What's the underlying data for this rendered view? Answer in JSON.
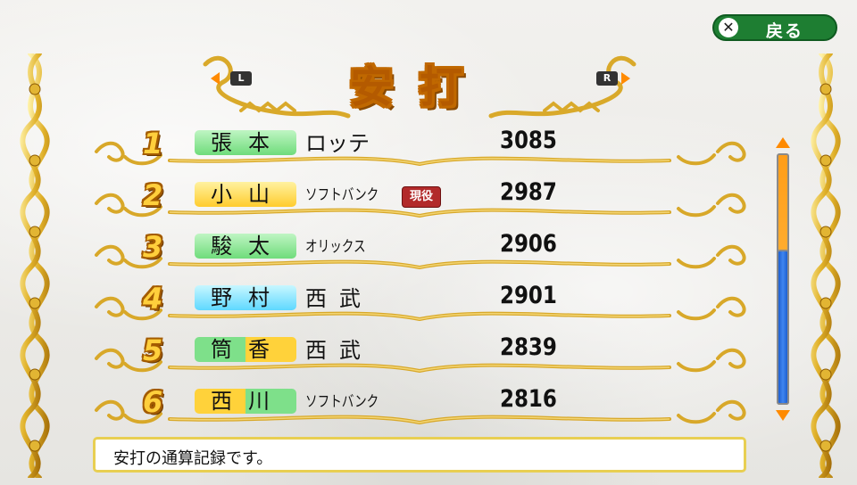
{
  "back_button": {
    "label": "戻る",
    "icon": "cross-button-icon"
  },
  "header": {
    "title": "安打",
    "left_shoulder": "L",
    "right_shoulder": "R"
  },
  "colors": {
    "green_badge": "#7ee08a",
    "yellow_badge": "#ffd23a",
    "cyan_badge": "#6fe3ff",
    "accent_orange": "#ff9d18",
    "thumb_blue": "#2f74e6",
    "active_red": "#b22a2a"
  },
  "rankings": [
    {
      "rank": "1",
      "name": "張本",
      "team": "ロッテ",
      "active": "",
      "hits": "3085",
      "badge_color": "green"
    },
    {
      "rank": "2",
      "name": "小山",
      "team": "ソフトバンク",
      "active": "現役",
      "hits": "2987",
      "badge_color": "yellow"
    },
    {
      "rank": "3",
      "name": "駿太",
      "team": "オリックス",
      "active": "",
      "hits": "2906",
      "badge_color": "green"
    },
    {
      "rank": "4",
      "name": "野村",
      "team": "西武",
      "active": "",
      "hits": "2901",
      "badge_color": "cyan"
    },
    {
      "rank": "5",
      "name": "筒香",
      "team": "西武",
      "active": "",
      "hits": "2839",
      "badge_color": "green-yellow"
    },
    {
      "rank": "6",
      "name": "西川",
      "team": "ソフトバンク",
      "active": "",
      "hits": "2816",
      "badge_color": "yellow-green"
    }
  ],
  "scrollbar": {
    "position": 0.58
  },
  "message": "安打の通算記録です。"
}
